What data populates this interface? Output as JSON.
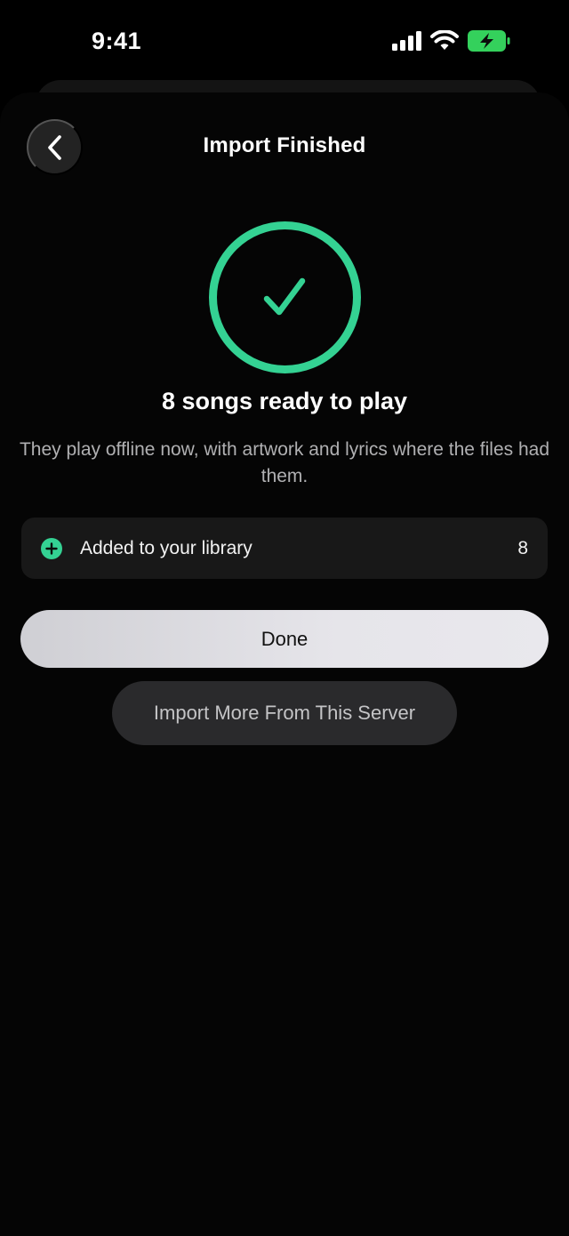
{
  "status_bar": {
    "time": "9:41"
  },
  "header": {
    "title": "Import Finished",
    "back_icon": "chevron-left-icon"
  },
  "result": {
    "icon": "checkmark-circle-icon",
    "accent_color": "#34d293",
    "headline": "8 songs ready to play",
    "description": "They play offline now, with artwork and lyrics where the files had them."
  },
  "summary": {
    "icon": "plus-circle-icon",
    "label": "Added to your library",
    "count": "8"
  },
  "actions": {
    "done_label": "Done",
    "import_more_label": "Import More From This Server"
  }
}
